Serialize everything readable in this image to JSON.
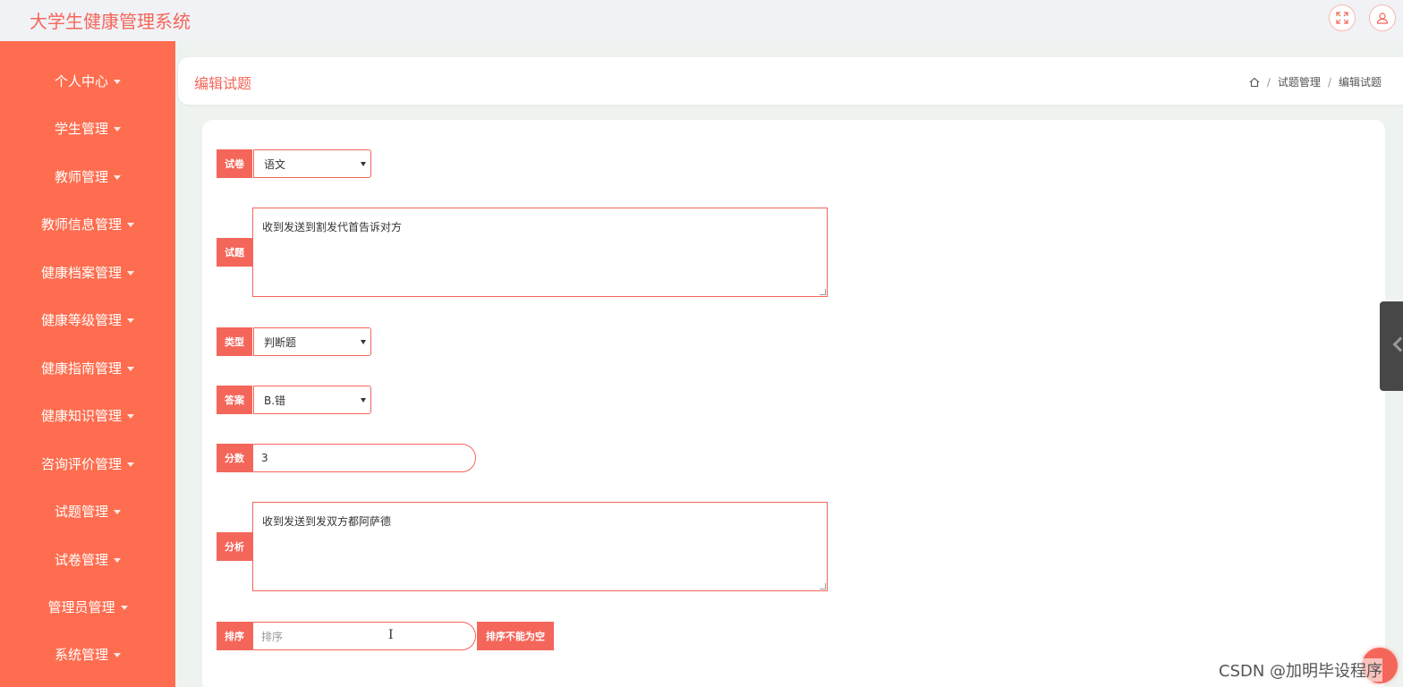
{
  "header": {
    "app_title": "大学生健康管理系统"
  },
  "sidebar": {
    "items": [
      {
        "label": "个人中心"
      },
      {
        "label": "学生管理"
      },
      {
        "label": "教师管理"
      },
      {
        "label": "教师信息管理"
      },
      {
        "label": "健康档案管理"
      },
      {
        "label": "健康等级管理"
      },
      {
        "label": "健康指南管理"
      },
      {
        "label": "健康知识管理"
      },
      {
        "label": "咨询评价管理"
      },
      {
        "label": "试题管理"
      },
      {
        "label": "试卷管理"
      },
      {
        "label": "管理员管理"
      },
      {
        "label": "系统管理"
      }
    ]
  },
  "page": {
    "title": "编辑试题",
    "breadcrumb": [
      "试题管理",
      "编辑试题"
    ]
  },
  "form": {
    "paper": {
      "label": "试卷",
      "value": "语文"
    },
    "question": {
      "label": "试题",
      "value": "收到发送到割发代首告诉对方"
    },
    "type": {
      "label": "类型",
      "value": "判断题"
    },
    "answer": {
      "label": "答案",
      "value": "B.错"
    },
    "score": {
      "label": "分数",
      "value": "3"
    },
    "analysis": {
      "label": "分析",
      "value": "收到发送到发双方都阿萨德"
    },
    "sort": {
      "label": "排序",
      "placeholder": "排序",
      "error": "排序不能为空"
    }
  },
  "watermark": "CSDN @加明毕设程序",
  "colors": {
    "accent": "#f4665a",
    "sidebar": "#fe6d4f"
  },
  "icons": [
    "fullscreen-icon",
    "user-icon",
    "home-icon",
    "text-cursor-icon",
    "chevron-left-icon"
  ]
}
